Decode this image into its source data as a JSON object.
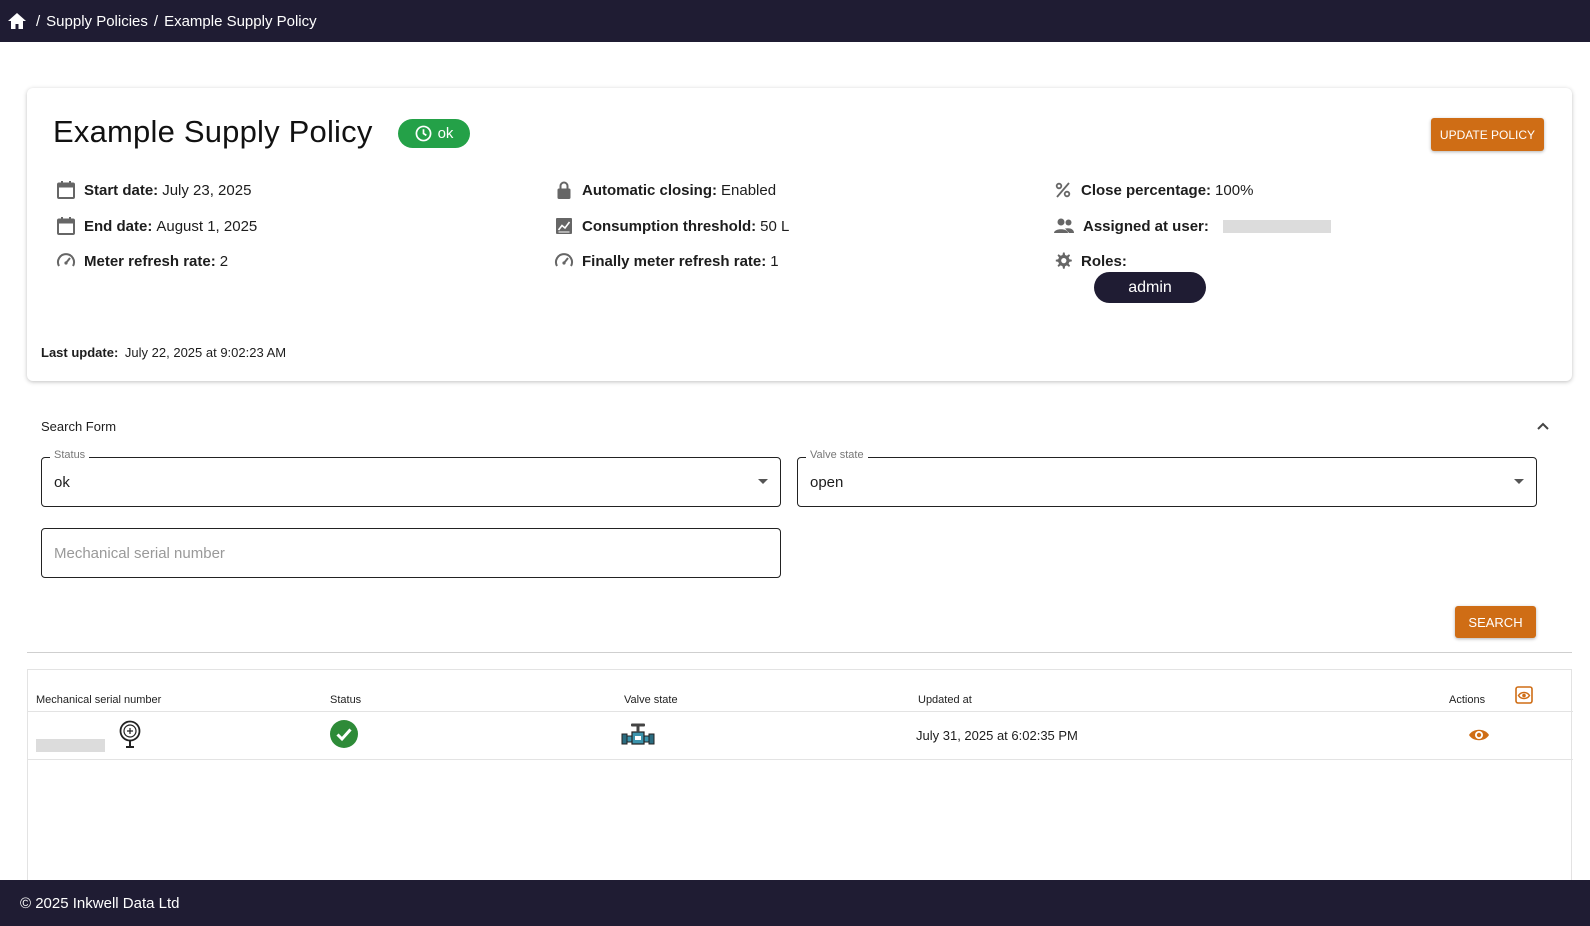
{
  "breadcrumb": {
    "separator": "/",
    "items": [
      "Supply Policies",
      "Example Supply Policy"
    ]
  },
  "policy": {
    "title": "Example Supply Policy",
    "status_badge": "ok",
    "update_button": "UPDATE POLICY",
    "start_date_label": "Start date:",
    "start_date": "July 23, 2025",
    "end_date_label": "End date:",
    "end_date": "August 1, 2025",
    "meter_refresh_label": "Meter refresh rate:",
    "meter_refresh": "2",
    "auto_closing_label": "Automatic closing:",
    "auto_closing": "Enabled",
    "consumption_label": "Consumption threshold:",
    "consumption": "50 L",
    "final_refresh_label": "Finally meter refresh rate:",
    "final_refresh": "1",
    "close_pct_label": "Close percentage:",
    "close_pct": "100%",
    "assigned_label": "Assigned at user:",
    "roles_label": "Roles:",
    "roles": [
      "admin"
    ],
    "last_update_label": "Last update:",
    "last_update": "July 22, 2025 at 9:02:23 AM"
  },
  "search": {
    "title": "Search Form",
    "status_legend": "Status",
    "status_value": "ok",
    "valve_legend": "Valve state",
    "valve_value": "open",
    "serial_placeholder": "Mechanical serial number",
    "search_button": "SEARCH"
  },
  "table": {
    "columns": [
      "Mechanical serial number",
      "Status",
      "Valve state",
      "Updated at",
      "Actions"
    ],
    "rows": [
      {
        "updated_at": "July 31, 2025 at 6:02:35 PM"
      }
    ]
  },
  "footer": {
    "text": "© 2025 Inkwell Data Ltd"
  },
  "colors": {
    "navy": "#1f1c33",
    "accent": "#cf6d15",
    "ok_green": "#24a148"
  },
  "icons": [
    "home-icon",
    "clock-icon",
    "calendar-icon",
    "speedometer-icon",
    "lock-icon",
    "chart-icon",
    "percent-icon",
    "users-icon",
    "gear-icon",
    "chevron-up-icon",
    "caret-down-icon",
    "meter-icon",
    "check-circle-icon",
    "valve-icon",
    "eye-icon",
    "visibility-settings-icon"
  ]
}
